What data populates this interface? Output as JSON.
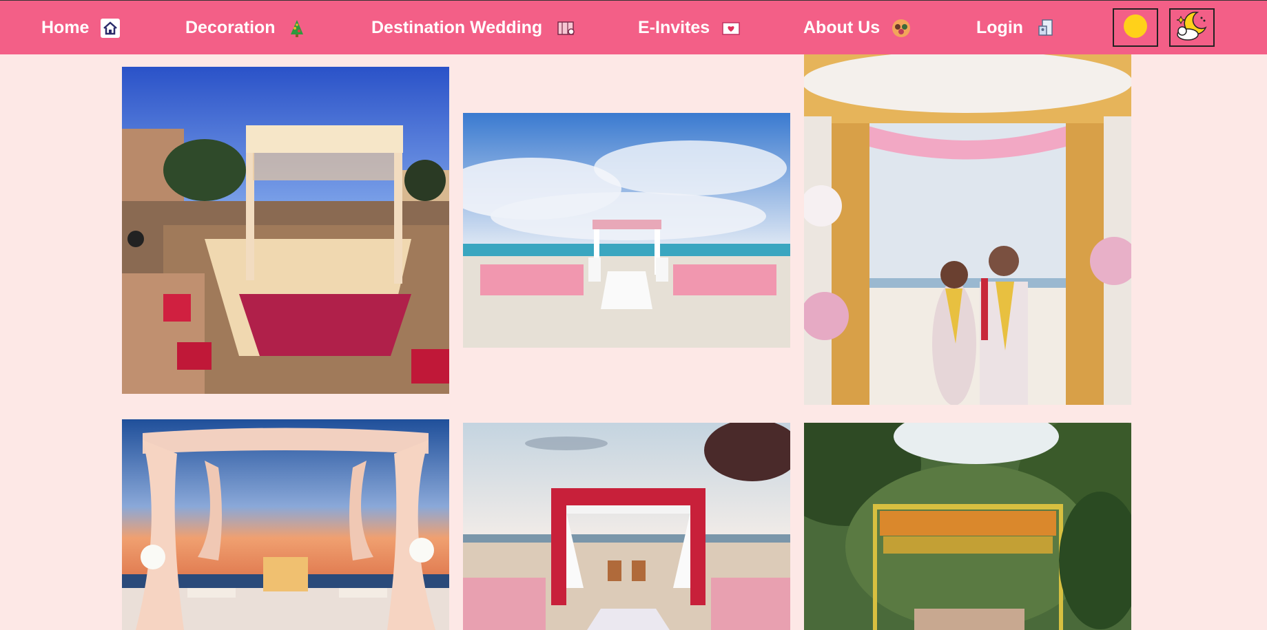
{
  "nav": {
    "items": [
      {
        "label": "Home",
        "icon": "house-icon"
      },
      {
        "label": "Decoration",
        "icon": "christmas-tree-icon"
      },
      {
        "label": "Destination Wedding",
        "icon": "map-icon"
      },
      {
        "label": "E-Invites",
        "icon": "envelope-heart-icon"
      },
      {
        "label": "About Us",
        "icon": "group-avatar-icon"
      },
      {
        "label": "Login",
        "icon": "login-icon"
      }
    ],
    "theme_buttons": [
      "sun-icon",
      "moon-cloud-icon"
    ]
  },
  "gallery": {
    "photos": [
      "palace-courtyard-mandap-photo",
      "beach-aisle-ceremony-photo",
      "floral-mandap-couple-photo",
      "sunset-drape-canopy-photo",
      "red-floral-beach-mandap-photo",
      "garden-marigold-canopy-photo"
    ]
  },
  "colors": {
    "nav_bg": "#f35f87",
    "page_bg": "#fde8e6"
  }
}
